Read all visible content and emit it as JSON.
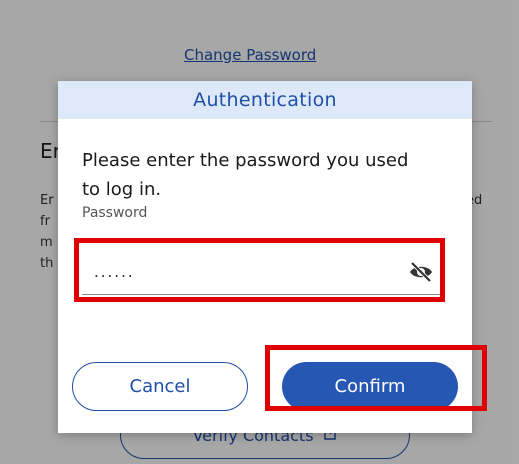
{
  "background": {
    "change_password_link": "Change Password",
    "section_heading": "Er",
    "body_text_left": [
      "Er",
      "fr",
      "m",
      "th"
    ],
    "body_text_right": "ed",
    "verify_contacts_label": "Verify Contacts",
    "verify_contacts_icon": "external-link-icon"
  },
  "dialog": {
    "title": "Authentication",
    "message": "Please enter the password you used to log in.",
    "password_label": "Password",
    "password_value": "......",
    "visibility_icon": "eye-off-icon",
    "cancel_label": "Cancel",
    "confirm_label": "Confirm"
  },
  "colors": {
    "accent": "#2557b3",
    "header_bg": "#dde9f8",
    "annotation": "#e10000"
  }
}
